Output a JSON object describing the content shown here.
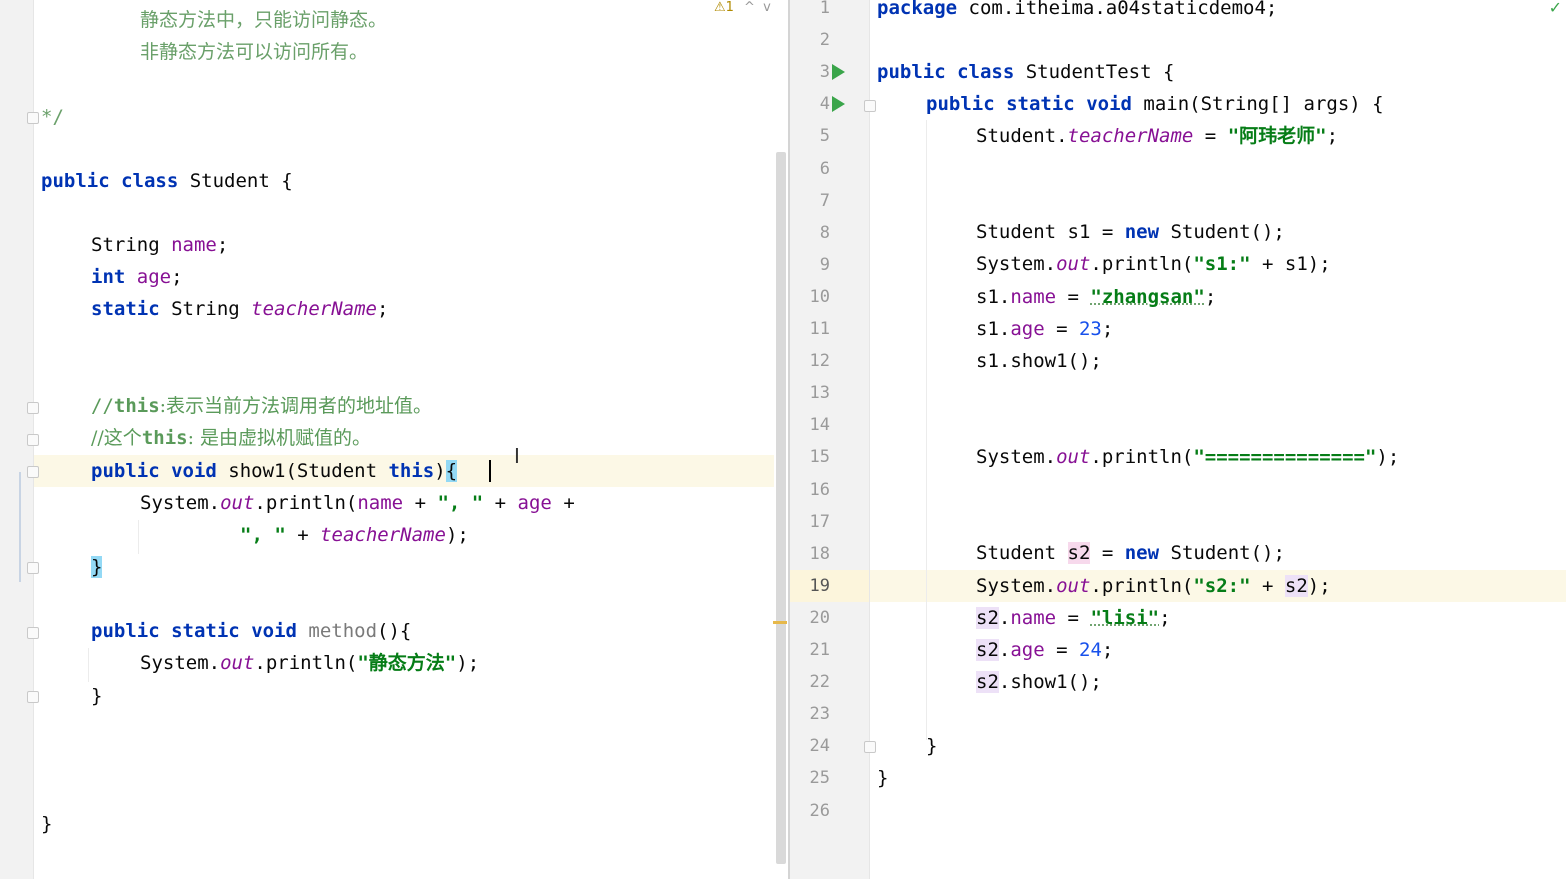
{
  "left_editor": {
    "inspection": {
      "icon": "warning-icon",
      "count": "1",
      "up": "^",
      "down": "v"
    },
    "lines": {
      "doc1": "静态方法中，只能访问静态。",
      "doc2": "非静态方法可以访问所有。",
      "doc_end": "*/",
      "class_kw1": "public",
      "class_kw2": "class",
      "class_name": " Student {",
      "f1_type": "String",
      "f1_name": "name",
      "f1_end": ";",
      "f2_type": "int",
      "f2_name": "age",
      "f2_end": ";",
      "f3_kw": "static",
      "f3_type": " String ",
      "f3_name": "teacherName",
      "f3_end": ";",
      "c1_prefix": "//",
      "c1_kw": "this",
      "c1_text": ":表示当前方法调用者的地址值。",
      "c2_prefix": "//这个",
      "c2_kw": "this",
      "c2_text": ": 是由虚拟机赋值的。",
      "m1_kw1": "public",
      "m1_kw2": "void",
      "m1_sig": " show1(Student ",
      "m1_this": "this",
      "m1_close": ")",
      "m1_brace": "{",
      "p1_sys": "System.",
      "p1_out": "out",
      "p1_call": ".println(",
      "p1_name": "name",
      "p1_plus1": " + ",
      "p1_str1": "\", \"",
      "p1_plus2": " + ",
      "p1_age": "age",
      "p1_plus3": " +",
      "p2_str": "\", \"",
      "p2_plus": " + ",
      "p2_tn": "teacherName",
      "p2_end": ");",
      "m1_end": "}",
      "m2_kw1": "public",
      "m2_kw2": "static",
      "m2_kw3": "void",
      "m2_name": "method",
      "m2_sig": "(){",
      "p3_sys": "System.",
      "p3_out": "out",
      "p3_call": ".println(",
      "p3_str": "\"静态方法\"",
      "p3_end": ");",
      "m2_end": "}",
      "class_end": "}"
    }
  },
  "right_editor": {
    "status_icon": "check-icon",
    "line_numbers": [
      "1",
      "2",
      "3",
      "4",
      "5",
      "6",
      "7",
      "8",
      "9",
      "10",
      "11",
      "12",
      "13",
      "14",
      "15",
      "16",
      "17",
      "18",
      "19",
      "20",
      "21",
      "22",
      "23",
      "24",
      "25",
      "26"
    ],
    "current_line": "19",
    "run_icons": [
      "run-icon-line-3",
      "run-icon-line-4"
    ],
    "lines": {
      "l1_kw": "package",
      "l1_rest": " com.itheima.a04staticdemo4;",
      "l3_kw1": "public",
      "l3_kw2": "class",
      "l3_rest": " StudentTest {",
      "l4_kw1": "public",
      "l4_kw2": "static",
      "l4_kw3": "void",
      "l4_rest": " main(String[] args) {",
      "l5_a": "Student.",
      "l5_field": "teacherName",
      "l5_eq": " = ",
      "l5_str": "\"阿玮老师\"",
      "l5_end": ";",
      "l8_a": "Student s1 = ",
      "l8_new": "new",
      "l8_b": " Student();",
      "l9_a": "System.",
      "l9_out": "out",
      "l9_b": ".println(",
      "l9_str": "\"s1:\"",
      "l9_c": " + s1);",
      "l10_a": "s1.",
      "l10_field": "name",
      "l10_eq": " = ",
      "l10_str": "\"zhangsan\"",
      "l10_end": ";",
      "l11_a": "s1.",
      "l11_field": "age",
      "l11_eq": " = ",
      "l11_num": "23",
      "l11_end": ";",
      "l12": "s1.show1();",
      "l15_a": "System.",
      "l15_out": "out",
      "l15_b": ".println(",
      "l15_str": "\"==============\"",
      "l15_end": ");",
      "l18_a": "Student ",
      "l18_var": "s2",
      "l18_b": " = ",
      "l18_new": "new",
      "l18_c": " Student();",
      "l19_a": "System.",
      "l19_out": "out",
      "l19_b": ".println(",
      "l19_str": "\"s2:\"",
      "l19_c": " + ",
      "l19_var": "s2",
      "l19_end": ");",
      "l20_var": "s2",
      "l20_dot": ".",
      "l20_field": "name",
      "l20_eq": " = ",
      "l20_str": "\"lisi\"",
      "l20_end": ";",
      "l21_var": "s2",
      "l21_dot": ".",
      "l21_field": "age",
      "l21_eq": " = ",
      "l21_num": "24",
      "l21_end": ";",
      "l22_var": "s2",
      "l22_rest": ".show1();",
      "l24": "}",
      "l25": "}"
    }
  }
}
